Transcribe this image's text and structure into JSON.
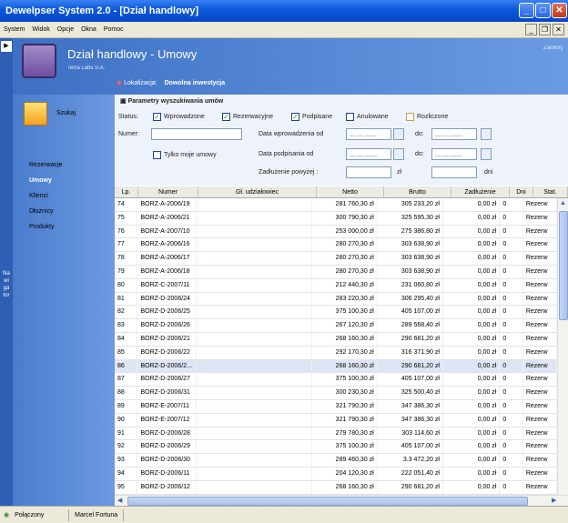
{
  "window": {
    "title": "Dewelpser System 2.0 - [Dział handlowy]"
  },
  "menu": [
    "System",
    "Widok",
    "Opcje",
    "Okna",
    "Pomoc"
  ],
  "nav": {
    "label": "Nawigator"
  },
  "header": {
    "title": "Dział handlowy - Umowy",
    "subtitle": "Terra Labs S.A.",
    "corner": "Zamknij"
  },
  "location": {
    "label": "Lokalizacja:",
    "value": "Dowolna inwestycja"
  },
  "search_button": {
    "label": "Szukaj"
  },
  "side_nav": [
    "Rezerwacje",
    "Umowy",
    "Klienci",
    "Dłużnicy",
    "Produkty"
  ],
  "filters": {
    "title": "Parametry wyszukiwania umów",
    "status_label": "Status:",
    "statuses": [
      {
        "label": "Wprowadzone",
        "checked": true
      },
      {
        "label": "Rezerwacyjne",
        "checked": true
      },
      {
        "label": "Podpisane",
        "checked": true
      },
      {
        "label": "Anulowane",
        "checked": false
      },
      {
        "label": "Rozliczone",
        "checked": false
      }
    ],
    "number_label": "Numer:",
    "only_mine": "Tylko moje umowy",
    "date_entered": "Data wprowadzenia od",
    "date_signed": "Data podpisania od",
    "to": "do:",
    "debt": "Zadłużenie powyżej :",
    "currency": "zł",
    "days": "dni",
    "date_placeholder": "__ __ ____"
  },
  "columns": [
    "Lp.",
    "Numer",
    "Gł. udziałowiec",
    "Netto",
    "Brutto",
    "Zadłużenie",
    "Dni",
    "Stat."
  ],
  "rows": [
    {
      "lp": "74",
      "num": "BORZ-A-2006/19",
      "name": "",
      "netto": "281 760,30 zł",
      "brutto": "305 233,20 zł",
      "zad": "0,00 zł",
      "dni": "0",
      "stat": "Rezerw"
    },
    {
      "lp": "75",
      "num": "BORZ-A-2006/21",
      "name": "",
      "netto": "300 790,30 zł",
      "brutto": "325 595,30 zł",
      "zad": "0,00 zł",
      "dni": "0",
      "stat": "Rezerw"
    },
    {
      "lp": "76",
      "num": "BORZ-A-2007/10",
      "name": "",
      "netto": "253 000,00 zł",
      "brutto": "275 386,80 zł",
      "zad": "0,00 zł",
      "dni": "0",
      "stat": "Rezerw"
    },
    {
      "lp": "77",
      "num": "BORZ-A-2006/16",
      "name": "",
      "netto": "280 270,30 zł",
      "brutto": "303 638,90 zł",
      "zad": "0,00 zł",
      "dni": "0",
      "stat": "Rezerw"
    },
    {
      "lp": "78",
      "num": "BORZ-A-2006/17",
      "name": "",
      "netto": "280 270,30 zł",
      "brutto": "303 638,90 zł",
      "zad": "0,00 zł",
      "dni": "0",
      "stat": "Rezerw"
    },
    {
      "lp": "79",
      "num": "BORZ-A-2006/18",
      "name": "",
      "netto": "280 270,30 zł",
      "brutto": "303 638,90 zł",
      "zad": "0,00 zł",
      "dni": "0",
      "stat": "Rezerw"
    },
    {
      "lp": "80",
      "num": "BORZ-C-2007/11",
      "name": "",
      "netto": "212 440,30 zł",
      "brutto": "231 060,80 zł",
      "zad": "0,00 zł",
      "dni": "0",
      "stat": "Rezerw"
    },
    {
      "lp": "81",
      "num": "BORZ-D-2006/24",
      "name": "",
      "netto": "283 220,30 zł",
      "brutto": "306 295,40 zł",
      "zad": "0,00 zł",
      "dni": "0",
      "stat": "Rezerw"
    },
    {
      "lp": "82",
      "num": "BORZ-D-2006/25",
      "name": "",
      "netto": "375 100,30 zł",
      "brutto": "405 107,00 zł",
      "zad": "0,00 zł",
      "dni": "0",
      "stat": "Rezerw"
    },
    {
      "lp": "83",
      "num": "BORZ-D-2006/26",
      "name": "",
      "netto": "267 120,30 zł",
      "brutto": "289 568,40 zł",
      "zad": "0,00 zł",
      "dni": "0",
      "stat": "Rezerw"
    },
    {
      "lp": "84",
      "num": "BORZ-D-2006/21",
      "name": "",
      "netto": "268 160,30 zł",
      "brutto": "290 681,20 zł",
      "zad": "0,00 zł",
      "dni": "0",
      "stat": "Rezerw"
    },
    {
      "lp": "85",
      "num": "BORZ-D-2006/22",
      "name": "",
      "netto": "292 170,30 zł",
      "brutto": "316 371,90 zł",
      "zad": "0,00 zł",
      "dni": "0",
      "stat": "Rezerw"
    },
    {
      "lp": "86",
      "num": "BORZ-D-2006/2...",
      "name": "",
      "netto": "268 160,30 zł",
      "brutto": "290 681,20 zł",
      "zad": "0,00 zł",
      "dni": "0",
      "stat": "Rezerw",
      "selected": true
    },
    {
      "lp": "87",
      "num": "BORZ-D-2006/27",
      "name": "",
      "netto": "375 100,30 zł",
      "brutto": "405 107,00 zł",
      "zad": "0,00 zł",
      "dni": "0",
      "stat": "Rezerw"
    },
    {
      "lp": "88",
      "num": "BORZ-D-2006/31",
      "name": "",
      "netto": "300 230,30 zł",
      "brutto": "325 500,40 zł",
      "zad": "0,00 zł",
      "dni": "0",
      "stat": "Rezerw"
    },
    {
      "lp": "89",
      "num": "BORZ-E-2007/11",
      "name": "",
      "netto": "321 790,30 zł",
      "brutto": "347 386,30 zł",
      "zad": "0,00 zł",
      "dni": "0",
      "stat": "Rezerw"
    },
    {
      "lp": "90",
      "num": "BORZ-E-2007/12",
      "name": "",
      "netto": "321 790,30 zł",
      "brutto": "347 386,30 zł",
      "zad": "0,00 zł",
      "dni": "0",
      "stat": "Rezerw"
    },
    {
      "lp": "91",
      "num": "BORZ-D-2006/28",
      "name": "",
      "netto": "279 780,30 zł",
      "brutto": "303 114,60 zł",
      "zad": "0,00 zł",
      "dni": "0",
      "stat": "Rezerw"
    },
    {
      "lp": "92",
      "num": "BORZ-D-2006/29",
      "name": "",
      "netto": "375 100,30 zł",
      "brutto": "405 107,00 zł",
      "zad": "0,00 zł",
      "dni": "0",
      "stat": "Rezerw"
    },
    {
      "lp": "93",
      "num": "BORZ-D-2006/30",
      "name": "",
      "netto": "289 460,30 zł",
      "brutto": "3.3 472,20 zł",
      "zad": "0,00 zł",
      "dni": "0",
      "stat": "Rezerw"
    },
    {
      "lp": "94",
      "num": "BORZ-D-2006/11",
      "name": "",
      "netto": "204 120,30 zł",
      "brutto": "222 051,40 zł",
      "zad": "0,00 zł",
      "dni": "0",
      "stat": "Rezerw"
    },
    {
      "lp": "95",
      "num": "BORZ-D-2006/12",
      "name": "",
      "netto": "268 160,30 zł",
      "brutto": "290 681,20 zł",
      "zad": "0,00 zł",
      "dni": "0",
      "stat": "Rezerw"
    },
    {
      "lp": "96",
      "num": "BORZ-D-2006/13",
      "name": "",
      "netto": "375 100,30 zł",
      "brutto": "405 107,00 zł",
      "zad": "0,00 zł",
      "dni": "0",
      "stat": "Rezerw"
    }
  ],
  "statusbar": {
    "connection": "Połączony",
    "user": "Marcel Fortuna"
  }
}
